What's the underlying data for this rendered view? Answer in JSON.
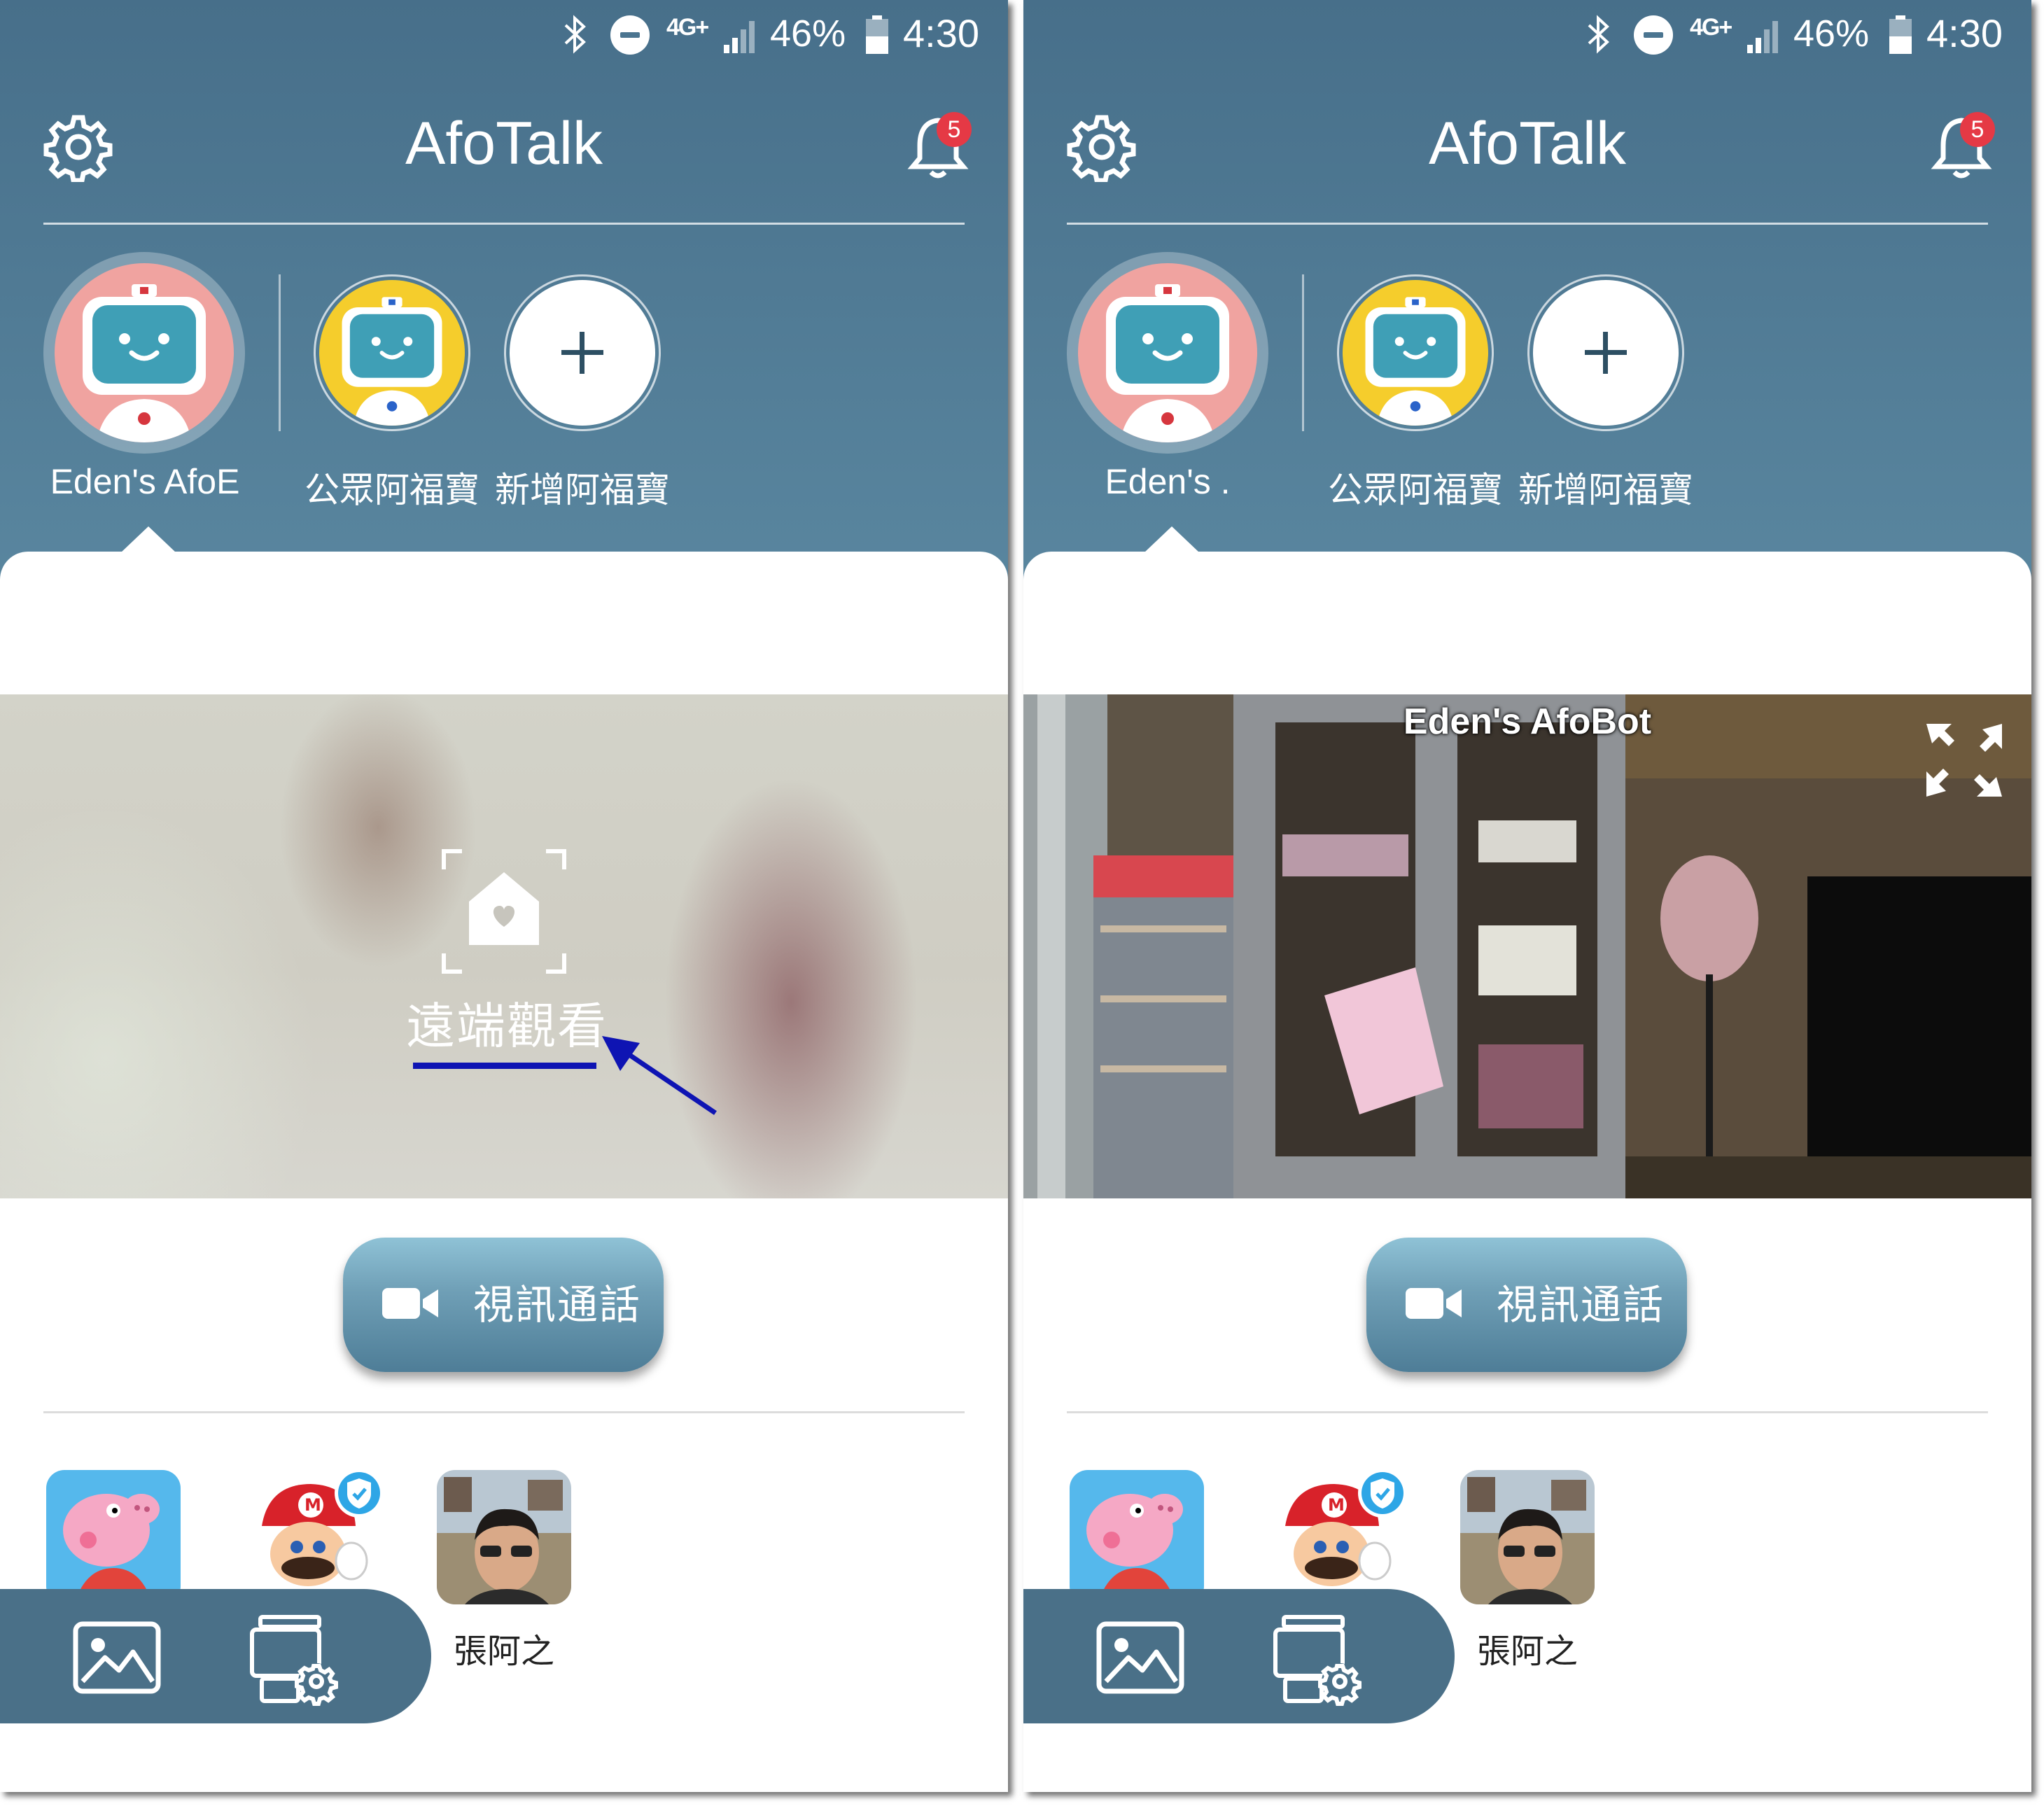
{
  "status_bar": {
    "network": "4G+",
    "battery": "46%",
    "time": "4:30"
  },
  "header": {
    "title": "AfoTalk",
    "notification_count": "5"
  },
  "bots": [
    {
      "name": "Eden's AfoBot",
      "color": "#f0a3a0",
      "selected": true
    },
    {
      "name": "公眾阿福寶",
      "color": "#f5cd2c",
      "selected": false
    },
    {
      "name": "新增阿福寶",
      "color": "#ffffff",
      "selected": false
    }
  ],
  "left_screen": {
    "bot_label_visible": "Eden's AfoE",
    "remote_view_label": "遠端觀看"
  },
  "right_screen": {
    "bot_label_visible": "Eden's .",
    "video_title": "Eden's AfoBot"
  },
  "call_button": {
    "label": "視訊通話"
  },
  "contacts": [
    {
      "name": "",
      "icon": "peppa-pig-avatar"
    },
    {
      "name": "",
      "icon": "mario-avatar",
      "verified": true
    },
    {
      "name": "張阿之",
      "icon": "photo-avatar"
    }
  ],
  "dock": {
    "items": [
      "gallery-icon",
      "device-settings-icon"
    ]
  },
  "colors": {
    "header": "#4b7590",
    "accent_annotation": "#0e14b3",
    "badge": "#e53945"
  }
}
